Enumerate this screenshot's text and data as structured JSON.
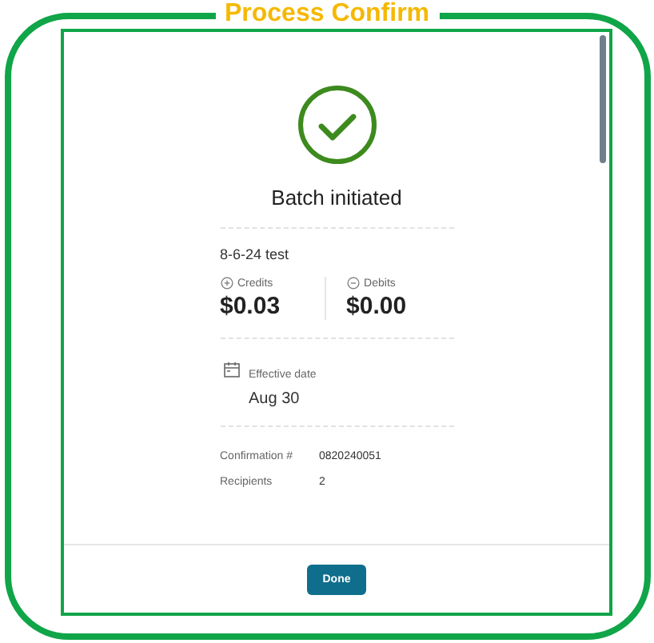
{
  "banner": {
    "title": "Process Confirm"
  },
  "dialog": {
    "status": "Batch initiated",
    "batch_name": "8-6-24 test",
    "totals": [
      {
        "kind": "credit",
        "label": "Credits",
        "amount": "$0.03"
      },
      {
        "kind": "debit",
        "label": "Debits",
        "amount": "$0.00"
      }
    ],
    "effective_date": {
      "label": "Effective date",
      "value": "Aug 30"
    },
    "details": [
      {
        "label": "Confirmation #",
        "value": "0820240051"
      },
      {
        "label": "Recipients",
        "value": "2"
      }
    ],
    "buttons": [
      "Done"
    ]
  }
}
